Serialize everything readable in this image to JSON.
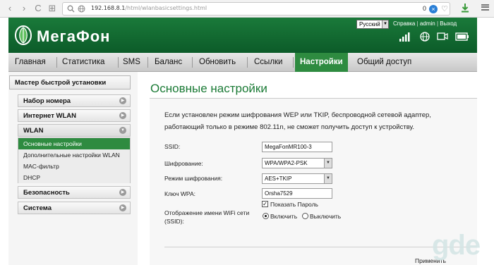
{
  "browser": {
    "url_host": "192.168.8.1",
    "url_path": "/html/wlanbasicsettings.html",
    "counter": "0",
    "badge": "×",
    "nav_back": "‹",
    "nav_forward": "›",
    "nav_reload": "C",
    "nav_tabs": "⊞",
    "bookmark": "♡"
  },
  "header": {
    "brand": "МегаФон",
    "language": "Русский",
    "links": [
      "Справка",
      "admin",
      "Выход"
    ],
    "brand_color": "#0c5b29"
  },
  "nav": {
    "items": [
      "Главная",
      "Статистика",
      "SMS",
      "Баланс",
      "Обновить",
      "Ссылки",
      "Настройки",
      "Общий доступ"
    ],
    "active": "Настройки"
  },
  "sidebar": {
    "quick_setup": "Мастер быстрой установки",
    "sections": [
      {
        "label": "Набор номера",
        "icon": "chevron-right-icon"
      },
      {
        "label": "Интернет WLAN",
        "icon": "chevron-right-icon"
      },
      {
        "label": "WLAN",
        "icon": "chevron-down-icon"
      },
      {
        "label": "Безопасность",
        "icon": "chevron-right-icon"
      },
      {
        "label": "Система",
        "icon": "chevron-right-icon"
      }
    ],
    "wlan_items": [
      "Основные настройки",
      "Дополнительные настройки WLAN",
      "MAC-фильтр",
      "DHCP"
    ],
    "active_item": "Основные настройки"
  },
  "main": {
    "title": "Основные настройки",
    "info": "Если установлен режим шифрования WEP или TKIP, беспроводной сетевой адаптер, работающий только в режиме 802.11n, не сможет получить доступ к устройству.",
    "ssid_label": "SSID:",
    "ssid_value": "MegaFonMR100-3",
    "encryption_label": "Шифрование:",
    "encryption_value": "WPA/WPA2-PSK",
    "mode_label": "Режим шифрования:",
    "mode_value": "AES+TKIP",
    "key_label": "Ключ WPA:",
    "key_value": "Orsha7529",
    "show_password": "Показать Пароль",
    "show_password_checked": true,
    "broadcast_label_1": "Отображение имени WiFi сети",
    "broadcast_label_2": "(SSID):",
    "broadcast_on": "Включить",
    "broadcast_off": "Выключить",
    "broadcast_selected": "Включить",
    "apply": "Применить"
  },
  "watermark": "gde"
}
